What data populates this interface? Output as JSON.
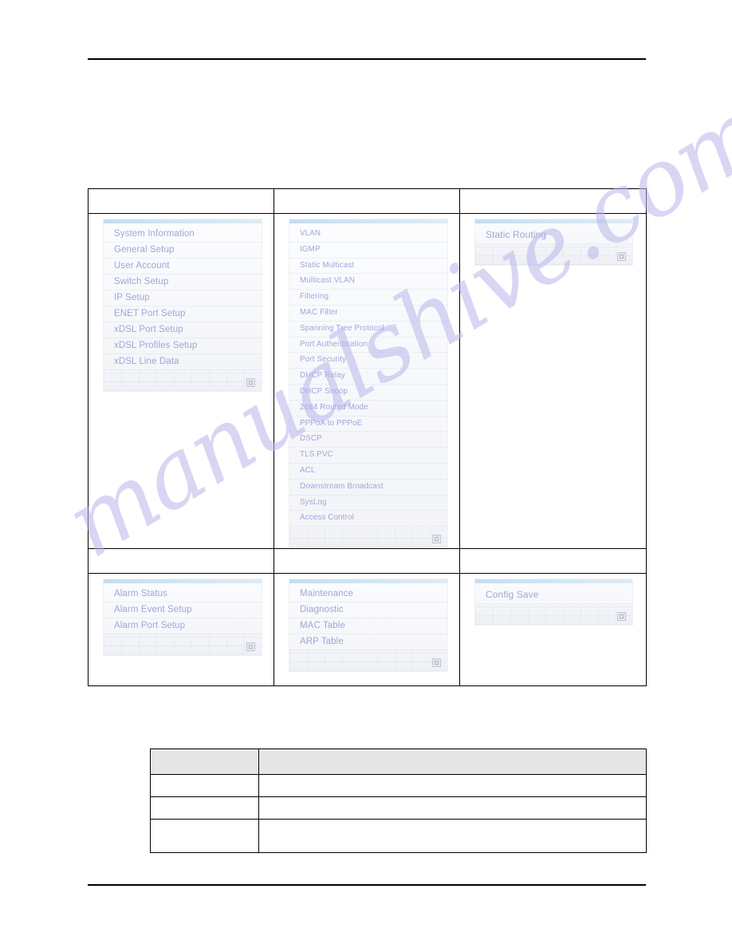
{
  "page": {
    "watermark": "manualshive.com",
    "header_rule": true,
    "footer_rule": true
  },
  "menu_table": {
    "header_row_1": [
      "",
      "",
      ""
    ],
    "header_row_2": [
      "",
      "",
      ""
    ],
    "panels": {
      "system": {
        "items": [
          "System Information",
          "General Setup",
          "User Account",
          "Switch Setup",
          "IP Setup",
          "ENET Port Setup",
          "xDSL Port Setup",
          "xDSL Profiles Setup",
          "xDSL Line Data"
        ]
      },
      "switching": {
        "items": [
          "VLAN",
          "IGMP",
          "Static Multicast",
          "Multicast VLAN",
          "Filtering",
          "MAC Filter",
          "Spanning Tree Protocol",
          "Port Authentication",
          "Port Security",
          "DHCP Relay",
          "DHCP Snoop",
          "2684 Routed Mode",
          "PPPoA to PPPoE",
          "DSCP",
          "TLS PVC",
          "ACL",
          "Downstream Broadcast",
          "SysLog",
          "Access Control"
        ]
      },
      "routing": {
        "items": [
          "Static Routing"
        ]
      },
      "alarm": {
        "items": [
          "Alarm Status",
          "Alarm Event Setup",
          "Alarm Port Setup"
        ]
      },
      "management": {
        "items": [
          "Maintenance",
          "Diagnostic",
          "MAC Table",
          "ARP Table"
        ]
      },
      "config": {
        "items": [
          "Config Save"
        ]
      }
    }
  },
  "desc_table": {
    "headers": [
      "",
      ""
    ],
    "rows": [
      [
        "",
        ""
      ],
      [
        "",
        ""
      ],
      [
        "",
        ""
      ]
    ]
  },
  "colors": {
    "menu_text": "#9a9ed6",
    "panel_topbar": "#c9dff1",
    "table_border": "#000000",
    "desc_header_bg": "#e6e6e6",
    "watermark": "#b9b6ea"
  }
}
